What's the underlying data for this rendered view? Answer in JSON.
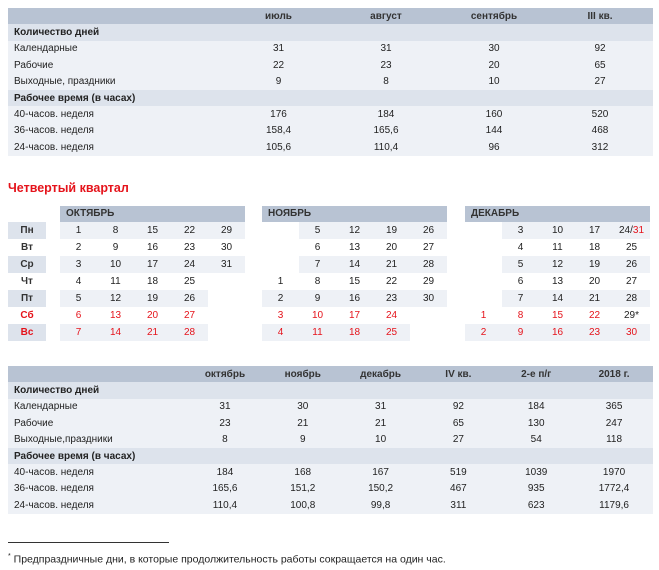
{
  "q3": {
    "headers": [
      "",
      "июль",
      "август",
      "сентябрь",
      "III кв."
    ],
    "sections": [
      {
        "title": "Количество дней",
        "rows": [
          {
            "label": "Календарные",
            "values": [
              "31",
              "31",
              "30",
              "92"
            ]
          },
          {
            "label": "Рабочие",
            "values": [
              "22",
              "23",
              "20",
              "65"
            ]
          },
          {
            "label": "Выходные, праздники",
            "values": [
              "9",
              "8",
              "10",
              "27"
            ]
          }
        ]
      },
      {
        "title": "Рабочее время (в часах)",
        "rows": [
          {
            "label": "40-часов. неделя",
            "values": [
              "176",
              "184",
              "160",
              "520"
            ]
          },
          {
            "label": "36-часов. неделя",
            "values": [
              "158,4",
              "165,6",
              "144",
              "468"
            ]
          },
          {
            "label": "24-часов. неделя",
            "values": [
              "105,6",
              "110,4",
              "96",
              "312"
            ]
          }
        ]
      }
    ]
  },
  "quarter_title": "Четвертый квартал",
  "weekdays": [
    "Пн",
    "Вт",
    "Ср",
    "Чт",
    "Пт",
    "Сб",
    "Вс"
  ],
  "months": [
    {
      "name": "ОКТЯБРЬ",
      "rows": [
        [
          "1",
          "8",
          "15",
          "22",
          "29"
        ],
        [
          "2",
          "9",
          "16",
          "23",
          "30"
        ],
        [
          "3",
          "10",
          "17",
          "24",
          "31"
        ],
        [
          "4",
          "11",
          "18",
          "25",
          ""
        ],
        [
          "5",
          "12",
          "19",
          "26",
          ""
        ],
        [
          "6",
          "13",
          "20",
          "27",
          ""
        ],
        [
          "7",
          "14",
          "21",
          "28",
          ""
        ]
      ]
    },
    {
      "name": "НОЯБРЬ",
      "rows": [
        [
          "",
          "5",
          "12",
          "19",
          "26"
        ],
        [
          "",
          "6",
          "13",
          "20",
          "27"
        ],
        [
          "",
          "7",
          "14",
          "21",
          "28"
        ],
        [
          "1",
          "8",
          "15",
          "22",
          "29"
        ],
        [
          "2",
          "9",
          "16",
          "23",
          "30"
        ],
        [
          "3",
          "10",
          "17",
          "24",
          ""
        ],
        [
          "4",
          "11",
          "18",
          "25",
          ""
        ]
      ]
    },
    {
      "name": "ДЕКАБРЬ",
      "rows": [
        [
          "",
          "3",
          "10",
          "17",
          "24/31"
        ],
        [
          "",
          "4",
          "11",
          "18",
          "25"
        ],
        [
          "",
          "5",
          "12",
          "19",
          "26"
        ],
        [
          "",
          "6",
          "13",
          "20",
          "27"
        ],
        [
          "",
          "7",
          "14",
          "21",
          "28"
        ],
        [
          "1",
          "8",
          "15",
          "22",
          "29*"
        ],
        [
          "2",
          "9",
          "16",
          "23",
          "30"
        ]
      ]
    }
  ],
  "q4": {
    "headers": [
      "",
      "октябрь",
      "ноябрь",
      "декабрь",
      "IV кв.",
      "2-е п/г",
      "2018 г."
    ],
    "sections": [
      {
        "title": "Количество дней",
        "rows": [
          {
            "label": "Календарные",
            "values": [
              "31",
              "30",
              "31",
              "92",
              "184",
              "365"
            ]
          },
          {
            "label": "Рабочие",
            "values": [
              "23",
              "21",
              "21",
              "65",
              "130",
              "247"
            ]
          },
          {
            "label": "Выходные,праздники",
            "values": [
              "8",
              "9",
              "10",
              "27",
              "54",
              "118"
            ]
          }
        ]
      },
      {
        "title": "Рабочее время (в часах)",
        "rows": [
          {
            "label": "40-часов. неделя",
            "values": [
              "184",
              "168",
              "167",
              "519",
              "1039",
              "1970"
            ]
          },
          {
            "label": "36-часов. неделя",
            "values": [
              "165,6",
              "151,2",
              "150,2",
              "467",
              "935",
              "1772,4"
            ]
          },
          {
            "label": "24-часов. неделя",
            "values": [
              "110,4",
              "100,8",
              "99,8",
              "311",
              "623",
              "1179,6"
            ]
          }
        ]
      }
    ]
  },
  "footnote": {
    "mark": "*",
    "text": " Предпраздничные дни, в которые продолжительность работы сокращается на один час."
  },
  "colors": {
    "header": "#b8c3d3",
    "section": "#dde3ec",
    "row_light": "#eef1f6",
    "weekend_red": "#e5131b"
  }
}
